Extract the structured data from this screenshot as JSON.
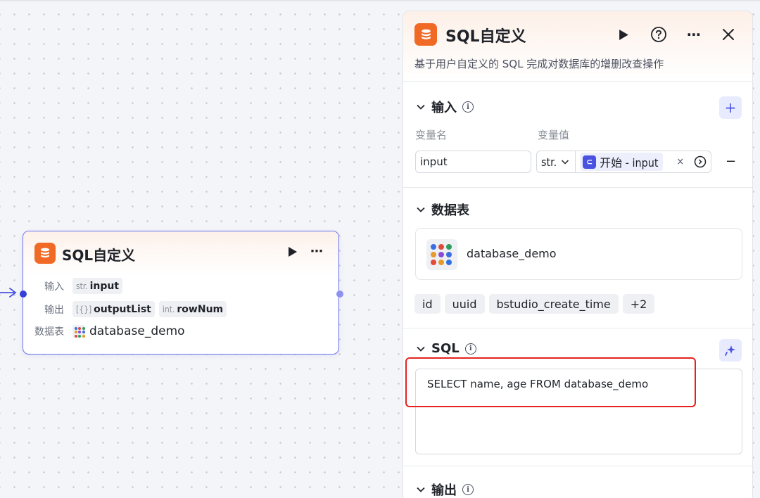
{
  "node": {
    "title": "SQL自定义",
    "input_label": "输入",
    "input_type": "str.",
    "input_name": "input",
    "output_label": "输出",
    "output1_type": "[{}]",
    "output1_name": "outputList",
    "output2_type": "int.",
    "output2_name": "rowNum",
    "db_label": "数据表",
    "db_name": "database_demo"
  },
  "panel": {
    "title": "SQL自定义",
    "description": "基于用户自定义的 SQL 完成对数据库的增删改查操作",
    "input_section": {
      "title": "输入",
      "col_name": "变量名",
      "col_value": "变量值",
      "var_name": "input",
      "var_type": "str.",
      "ref_label": "开始 - input"
    },
    "table_section": {
      "title": "数据表",
      "db_name": "database_demo",
      "fields": [
        "id",
        "uuid",
        "bstudio_create_time",
        "+2"
      ]
    },
    "sql_section": {
      "title": "SQL",
      "query": "SELECT name, age FROM database_demo"
    },
    "output_section": {
      "title": "输出"
    }
  },
  "colors": {
    "accent": "#4953e0",
    "node_border": "#6670f0",
    "db_icon": "#f06a25",
    "highlight": "#e5221f"
  }
}
